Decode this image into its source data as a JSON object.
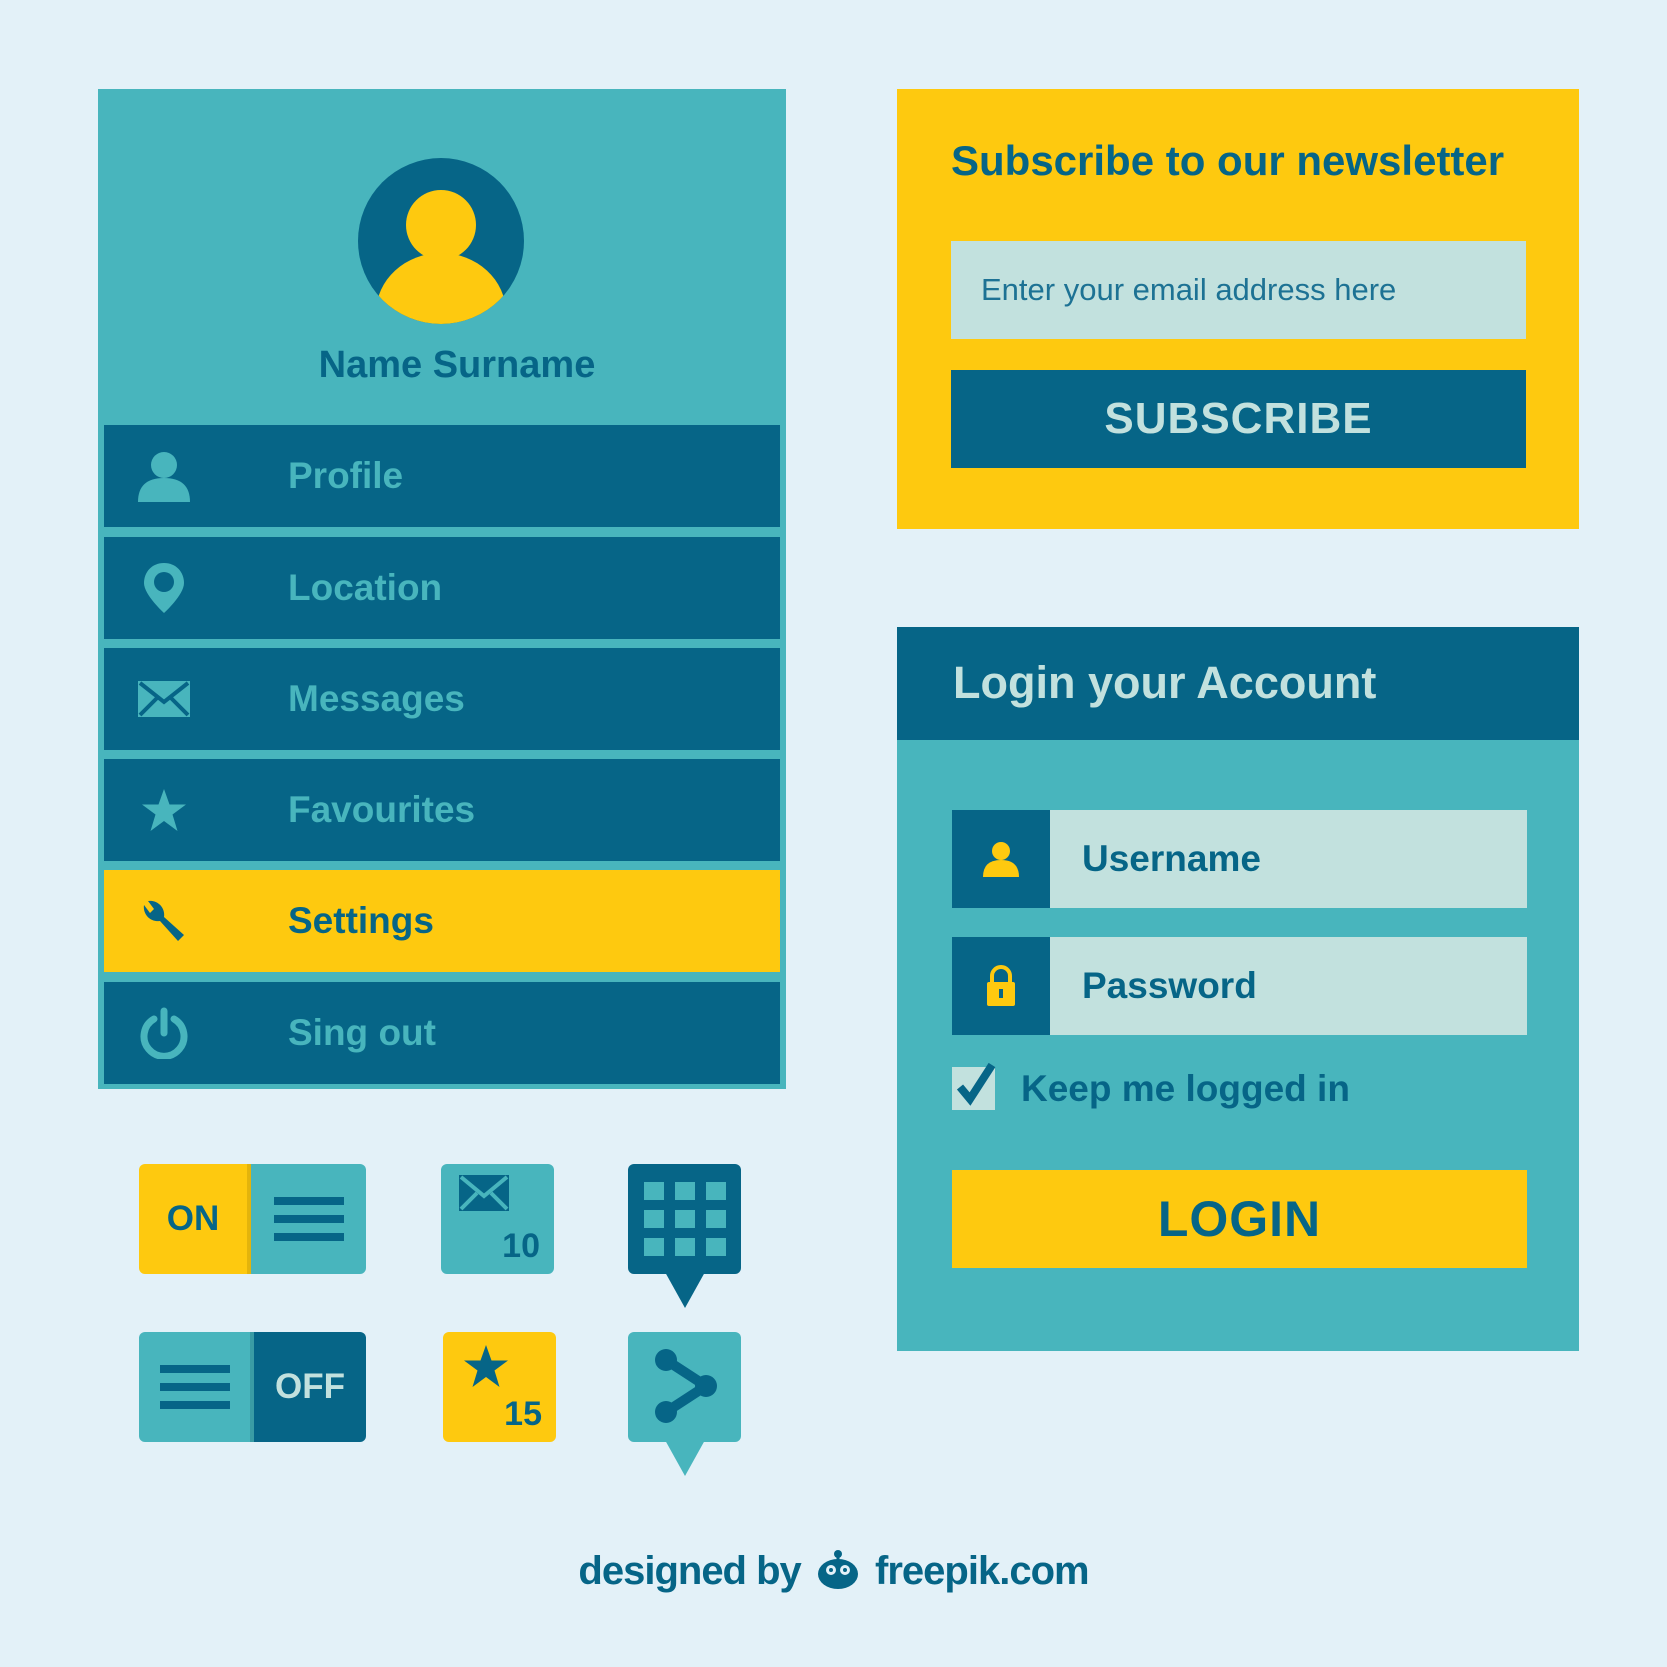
{
  "colors": {
    "background": "#e3f1f8",
    "teal": "#48b5bd",
    "dark_blue": "#066587",
    "yellow": "#fec90f",
    "pale": "#c2e1de"
  },
  "profile": {
    "name": "Name Surname",
    "menu": [
      {
        "label": "Profile",
        "icon": "user-icon",
        "active": false
      },
      {
        "label": "Location",
        "icon": "location-pin-icon",
        "active": false
      },
      {
        "label": "Messages",
        "icon": "envelope-icon",
        "active": false
      },
      {
        "label": "Favourites",
        "icon": "star-icon",
        "active": false
      },
      {
        "label": "Settings",
        "icon": "wrench-icon",
        "active": true
      },
      {
        "label": "Sing out",
        "icon": "power-icon",
        "active": false
      }
    ]
  },
  "newsletter": {
    "title": "Subscribe to our newsletter",
    "email_placeholder": "Enter your email address here",
    "email_value": "",
    "button_label": "SUBSCRIBE"
  },
  "login": {
    "title": "Login your Account",
    "username_placeholder": "Username",
    "password_placeholder": "Password",
    "keep_logged_in_label": "Keep me logged in",
    "keep_logged_in_checked": true,
    "button_label": "LOGIN"
  },
  "widgets": {
    "toggle_on_label": "ON",
    "toggle_off_label": "OFF",
    "messages_count": "10",
    "favourites_count": "15"
  },
  "credit": {
    "prefix": "designed by",
    "site": "freepik.com"
  }
}
